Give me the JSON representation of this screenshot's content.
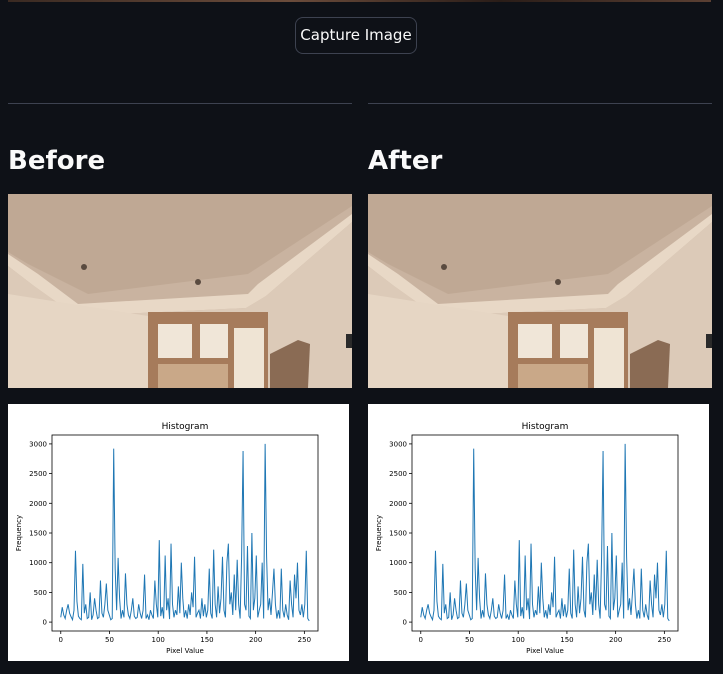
{
  "capture_button": {
    "label": "Capture Image"
  },
  "panels": [
    {
      "id": "before",
      "heading": "Before",
      "chart_data": {
        "type": "line",
        "title": "Histogram",
        "xlabel": "Pixel Value",
        "ylabel": "Frequency",
        "xlim": [
          -9,
          264
        ],
        "ylim": [
          -150,
          3150
        ],
        "xticks": [
          0,
          50,
          100,
          150,
          200,
          250
        ],
        "yticks": [
          0,
          500,
          1000,
          1500,
          2000,
          2500,
          3000
        ],
        "series": [
          {
            "color": "#1f77b4",
            "values": [
              80,
              250,
              120,
              60,
              200,
              300,
              150,
              90,
              40,
              200,
              1200,
              350,
              100,
              60,
              40,
              980,
              150,
              300,
              60,
              80,
              500,
              40,
              120,
              400,
              200,
              60,
              80,
              700,
              150,
              80,
              300,
              650,
              200,
              120,
              40,
              60,
              2920,
              900,
              200,
              1080,
              400,
              60,
              200,
              80,
              820,
              300,
              120,
              60,
              200,
              400,
              100,
              60,
              80,
              300,
              150,
              60,
              200,
              800,
              60,
              120,
              40,
              200,
              120,
              60,
              700,
              300,
              80,
              1380,
              100,
              250,
              60,
              1120,
              200,
              400,
              50,
              1320,
              300,
              80,
              200,
              120,
              600,
              150,
              1000,
              400,
              80,
              200,
              60,
              300,
              120,
              500,
              250,
              1100,
              80,
              150,
              200,
              60,
              400,
              100,
              300,
              80,
              200,
              900,
              150,
              60,
              1220,
              300,
              80,
              600,
              150,
              400,
              1100,
              200,
              80,
              1000,
              1320,
              300,
              500,
              120,
              800,
              200,
              1050,
              300,
              60,
              1100,
              2880,
              300,
              200,
              1280,
              100,
              60,
              1500,
              200,
              400,
              1120,
              80,
              200,
              300,
              1000,
              60,
              3000,
              1100,
              200,
              400,
              120,
              500,
              900,
              300,
              60,
              200,
              60,
              900,
              200,
              80,
              300,
              120,
              40,
              700,
              300,
              80,
              800,
              400,
              1000,
              200,
              120,
              300,
              80,
              300,
              1200,
              60,
              20
            ]
          }
        ]
      }
    },
    {
      "id": "after",
      "heading": "After",
      "chart_data": {
        "type": "line",
        "title": "Histogram",
        "xlabel": "Pixel Value",
        "ylabel": "Frequency",
        "xlim": [
          -9,
          264
        ],
        "ylim": [
          -150,
          3150
        ],
        "xticks": [
          0,
          50,
          100,
          150,
          200,
          250
        ],
        "yticks": [
          0,
          500,
          1000,
          1500,
          2000,
          2500,
          3000
        ],
        "series": [
          {
            "color": "#1f77b4",
            "values": [
              80,
              250,
              120,
              60,
              200,
              300,
              150,
              90,
              40,
              200,
              1200,
              350,
              100,
              60,
              40,
              980,
              150,
              300,
              60,
              80,
              500,
              40,
              120,
              400,
              200,
              60,
              80,
              700,
              150,
              80,
              300,
              650,
              200,
              120,
              40,
              60,
              2920,
              900,
              200,
              1080,
              400,
              60,
              200,
              80,
              820,
              300,
              120,
              60,
              200,
              400,
              100,
              60,
              80,
              300,
              150,
              60,
              200,
              800,
              60,
              120,
              40,
              200,
              120,
              60,
              700,
              300,
              80,
              1380,
              100,
              250,
              60,
              1120,
              200,
              400,
              50,
              1320,
              300,
              80,
              200,
              120,
              600,
              150,
              1000,
              400,
              80,
              200,
              60,
              300,
              120,
              500,
              250,
              1100,
              80,
              150,
              200,
              60,
              400,
              100,
              300,
              80,
              200,
              900,
              150,
              60,
              1220,
              300,
              80,
              600,
              150,
              400,
              1100,
              200,
              80,
              1000,
              1320,
              300,
              500,
              120,
              800,
              200,
              1050,
              300,
              60,
              1100,
              2880,
              300,
              200,
              1280,
              100,
              60,
              1500,
              200,
              400,
              1120,
              80,
              200,
              300,
              1000,
              60,
              3000,
              1100,
              200,
              400,
              120,
              500,
              900,
              300,
              60,
              200,
              60,
              900,
              200,
              80,
              300,
              120,
              40,
              700,
              300,
              80,
              800,
              400,
              1000,
              200,
              120,
              300,
              80,
              300,
              1200,
              60,
              20
            ]
          }
        ]
      }
    }
  ]
}
